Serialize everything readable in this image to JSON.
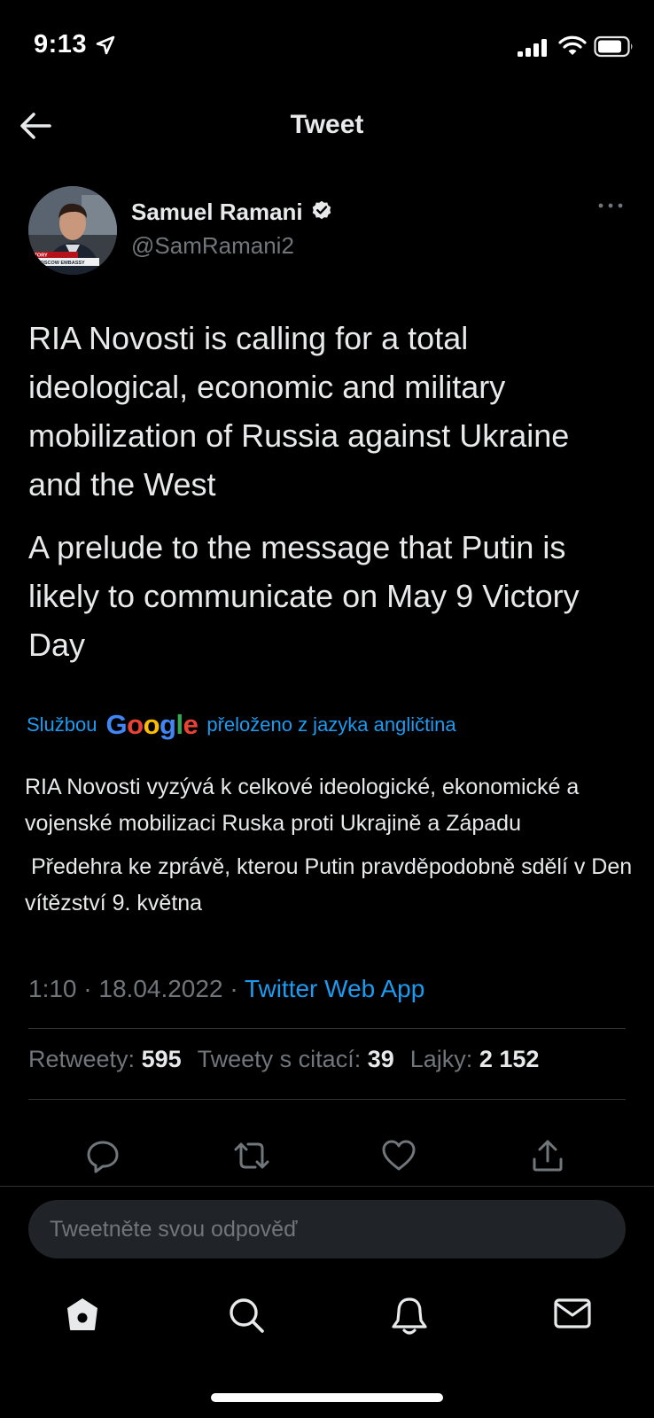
{
  "status_bar": {
    "time": "9:13"
  },
  "nav": {
    "title": "Tweet"
  },
  "author": {
    "name": "Samuel Ramani",
    "handle": "@SamRamani2",
    "avatar_caption_1": "STORY",
    "avatar_caption_2": "MOSCOW EMBASSY"
  },
  "tweet": {
    "paragraph_1": "RIA Novosti is calling for a total ideological, economic and military mobilization of Russia against Ukraine and the West",
    "paragraph_2": "A prelude to the message that Putin is likely to communicate on May 9 Victory Day"
  },
  "translation": {
    "by_prefix": "Službou",
    "provider_logo_text": "Google",
    "by_suffix": "přeloženo z jazyka angličtina",
    "paragraph_1": "RIA Novosti vyzývá k celkové ideologické, ekonomické a vojenské mobilizaci Ruska proti Ukrajině a Západu",
    "paragraph_2": " Předehra ke zprávě, kterou Putin pravděpodobně sdělí v Den vítězství 9. května"
  },
  "meta": {
    "time": "1:10",
    "separator": "·",
    "date": "18.04.2022",
    "source": "Twitter Web App"
  },
  "stats": {
    "retweets_label": "Retweety:",
    "retweets_count": "595",
    "quotes_label": "Tweety s citací:",
    "quotes_count": "39",
    "likes_label": "Lajky:",
    "likes_count": "2 152"
  },
  "reply": {
    "placeholder": "Tweetněte svou odpověď"
  },
  "icons": [
    "location-arrow-icon",
    "signal-icon",
    "wifi-icon",
    "battery-icon",
    "back-arrow-icon",
    "verified-icon",
    "more-icon",
    "reply-icon",
    "retweet-icon",
    "like-icon",
    "share-icon",
    "home-icon",
    "search-icon",
    "notifications-icon",
    "messages-icon"
  ],
  "colors": {
    "background": "#000000",
    "accent": "#1d9bf0",
    "text": "#e7e9ea",
    "secondary": "#71767b"
  }
}
